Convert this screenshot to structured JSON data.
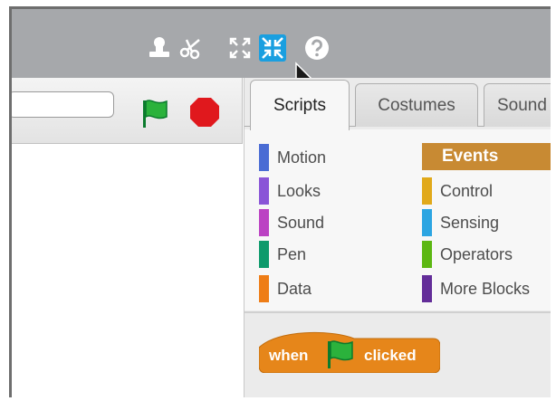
{
  "toolbar": {
    "tools": [
      {
        "name": "duplicate-icon"
      },
      {
        "name": "cut-icon"
      },
      {
        "name": "grow-icon"
      },
      {
        "name": "shrink-icon",
        "selected": true
      },
      {
        "name": "help-icon"
      }
    ]
  },
  "stage": {
    "project_title_value": "",
    "green_flag_icon": "green-flag-icon",
    "stop_icon": "stop-icon"
  },
  "tabs": [
    {
      "label": "Scripts",
      "active": true
    },
    {
      "label": "Costumes",
      "active": false
    },
    {
      "label": "Sound",
      "active": false
    }
  ],
  "categories": [
    {
      "label": "Motion",
      "color": "#4a6cd4"
    },
    {
      "label": "Looks",
      "color": "#8a55d7"
    },
    {
      "label": "Sound",
      "color": "#bb42c3"
    },
    {
      "label": "Pen",
      "color": "#0e9a6c"
    },
    {
      "label": "Data",
      "color": "#ee7d16"
    },
    {
      "label": "Events",
      "color": "#c88330",
      "selected": true
    },
    {
      "label": "Control",
      "color": "#e1a91a"
    },
    {
      "label": "Sensing",
      "color": "#2ca5e2"
    },
    {
      "label": "Operators",
      "color": "#5cb712"
    },
    {
      "label": "More Blocks",
      "color": "#632d99"
    }
  ],
  "script_block": {
    "word_before": "when",
    "icon": "green-flag-icon",
    "word_after": "clicked",
    "color": "#e6861a"
  }
}
